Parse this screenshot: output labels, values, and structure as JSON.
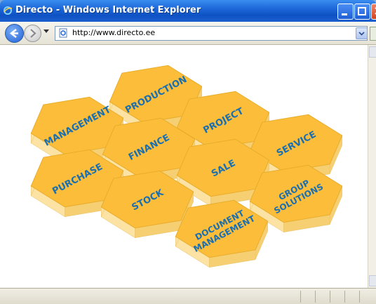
{
  "window": {
    "title": "Directo - Windows Internet Explorer"
  },
  "navbar": {
    "address": "http://www.directo.ee"
  },
  "hexagons": [
    {
      "label_lines": [
        "MANAGEMENT"
      ],
      "name": "management"
    },
    {
      "label_lines": [
        "PRODUCTION"
      ],
      "name": "production"
    },
    {
      "label_lines": [
        "PROJECT"
      ],
      "name": "project"
    },
    {
      "label_lines": [
        "FINANCE"
      ],
      "name": "finance"
    },
    {
      "label_lines": [
        "SERVICE"
      ],
      "name": "service"
    },
    {
      "label_lines": [
        "PURCHASE"
      ],
      "name": "purchase"
    },
    {
      "label_lines": [
        "SALE"
      ],
      "name": "sale"
    },
    {
      "label_lines": [
        "STOCK"
      ],
      "name": "stock"
    },
    {
      "label_lines": [
        "GROUP",
        "SOLUTIONS"
      ],
      "name": "group-solutions"
    },
    {
      "label_lines": [
        "DOCUMENT",
        "MANAGEMENT"
      ],
      "name": "document-management"
    }
  ],
  "colors": {
    "hex_top": "#fbbd3a",
    "hex_front": "#fde3a3",
    "hex_side": "#f6cf72",
    "label": "#1a6fb0"
  },
  "icons": [
    "ie-logo-icon",
    "back-arrow-icon",
    "forward-arrow-icon",
    "dropdown-arrow-icon",
    "page-icon",
    "minimize-icon",
    "maximize-icon",
    "close-icon"
  ]
}
